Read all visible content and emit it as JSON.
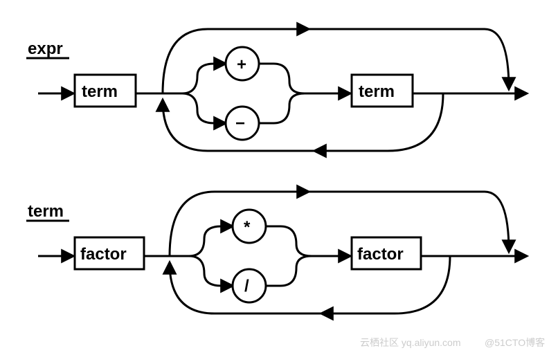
{
  "diagram": {
    "type": "syntax-railroad",
    "rules": [
      {
        "name": "expr",
        "first_box": "term",
        "op_top": "+",
        "op_bottom": "−",
        "second_box": "term"
      },
      {
        "name": "term",
        "first_box": "factor",
        "op_top": "*",
        "op_bottom": "/",
        "second_box": "factor"
      }
    ]
  },
  "watermark": {
    "left": "云栖社区 yq.aliyun.com",
    "right": "@51CTO博客"
  }
}
